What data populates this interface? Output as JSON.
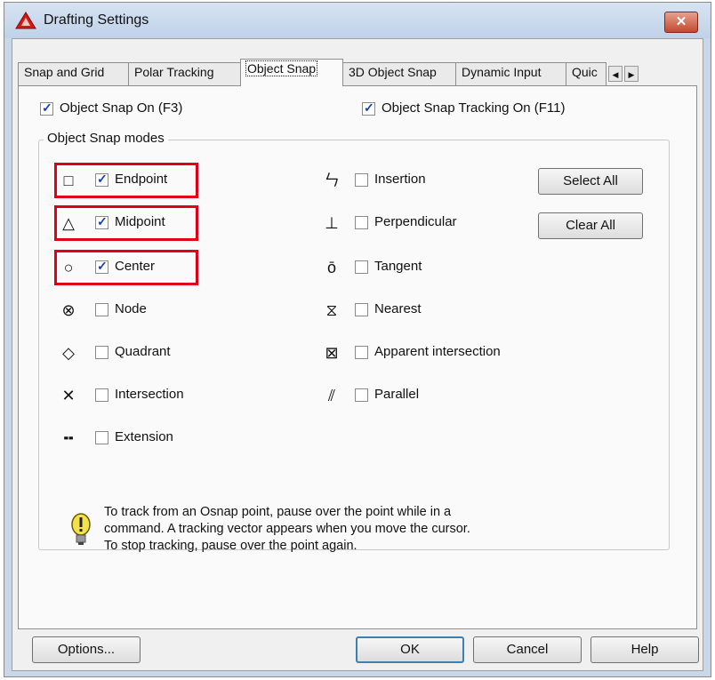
{
  "window": {
    "title": "Drafting Settings",
    "close_label": "✕"
  },
  "tabs": [
    {
      "label": "Snap and Grid",
      "active": false
    },
    {
      "label": "Polar Tracking",
      "active": false
    },
    {
      "label": "Object Snap",
      "active": true
    },
    {
      "label": "3D Object Snap",
      "active": false
    },
    {
      "label": "Dynamic Input",
      "active": false
    },
    {
      "label": "Quic",
      "active": false
    }
  ],
  "top_options": {
    "object_snap_on": {
      "label": "Object Snap On (F3)",
      "checked": true
    },
    "tracking_on": {
      "label": "Object Snap Tracking On (F11)",
      "checked": true
    }
  },
  "group": {
    "title": "Object Snap modes"
  },
  "modes_left": [
    {
      "label": "Endpoint",
      "symbol": "□",
      "checked": true,
      "highlighted": true
    },
    {
      "label": "Midpoint",
      "symbol": "△",
      "checked": true,
      "highlighted": true
    },
    {
      "label": "Center",
      "symbol": "○",
      "checked": true,
      "highlighted": true
    },
    {
      "label": "Node",
      "symbol": "⊗",
      "checked": false,
      "highlighted": false
    },
    {
      "label": "Quadrant",
      "symbol": "◇",
      "checked": false,
      "highlighted": false
    },
    {
      "label": "Intersection",
      "symbol": "✕",
      "checked": false,
      "highlighted": false
    },
    {
      "label": "Extension",
      "symbol": "╍",
      "checked": false,
      "highlighted": false
    }
  ],
  "modes_right": [
    {
      "label": "Insertion",
      "symbol": "ㄣ",
      "checked": false
    },
    {
      "label": "Perpendicular",
      "symbol": "⊥",
      "checked": false
    },
    {
      "label": "Tangent",
      "symbol": "ō",
      "checked": false
    },
    {
      "label": "Nearest",
      "symbol": "⧖",
      "checked": false
    },
    {
      "label": "Apparent intersection",
      "symbol": "⊠",
      "checked": false
    },
    {
      "label": "Parallel",
      "symbol": "⫽",
      "checked": false
    }
  ],
  "buttons": {
    "select_all": "Select All",
    "clear_all": "Clear All",
    "options": "Options...",
    "ok": "OK",
    "cancel": "Cancel",
    "help": "Help"
  },
  "tip": {
    "icon": "lightbulb-icon",
    "lines": [
      "To track from an Osnap point, pause over the point while in a",
      "command.  A tracking vector appears when you move the cursor.",
      "To stop tracking, pause over the point again."
    ]
  },
  "colors": {
    "highlight": "#e0001a",
    "check": "#1a3fb4",
    "title_bar": "#c9d7e8"
  }
}
